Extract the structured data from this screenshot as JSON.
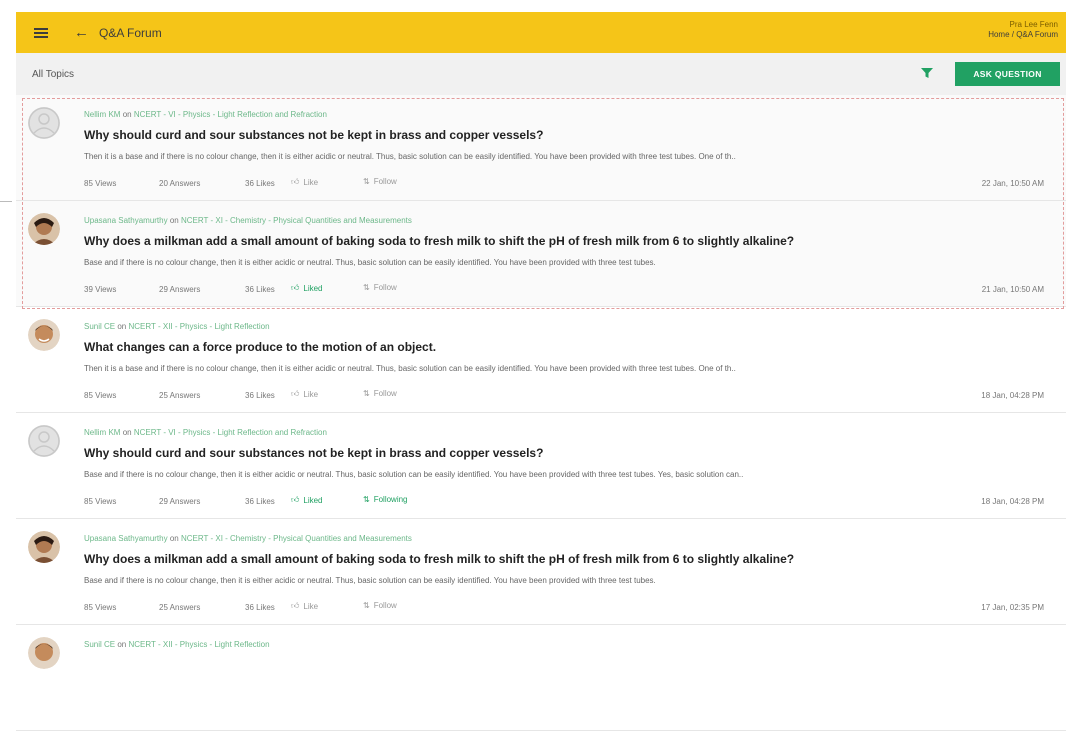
{
  "header": {
    "title": "Q&A Forum",
    "user_name": "Pra Lee Fenn",
    "breadcrumb": "Home / Q&A Forum"
  },
  "subheader": {
    "title": "All Topics",
    "ask_button": "ASK QUESTION"
  },
  "colors": {
    "brand": "#f5c518",
    "accent": "#21a163"
  },
  "icons": {
    "menu": "hamburger-icon",
    "back": "arrow-left-icon",
    "filter": "funnel-icon",
    "like": "thumbs-up-icon",
    "follow": "follow-icon"
  },
  "questions": [
    {
      "author": "Nellim KM",
      "on": "on",
      "topic": "NCERT - VI - Physics - Light Reflection and Refraction",
      "title": "Why should curd and sour substances not be kept in brass and copper vessels?",
      "snippet": "Then it is a base and if there is no colour change, then it is either acidic or neutral. Thus, basic solution can be easily identified. You have been provided with three test tubes. One of th..",
      "views": "85 Views",
      "answers": "20 Answers",
      "likes": "36 Likes",
      "like_label": "Like",
      "follow_label": "Follow",
      "date": "22 Jan, 10:50 AM"
    },
    {
      "author": "Upasana Sathyamurthy",
      "on": "on",
      "topic": "NCERT - XI - Chemistry - Physical Quantities and Measurements",
      "title": "Why does a milkman add a small amount of baking soda to fresh milk to shift the pH of fresh milk from 6 to slightly alkaline?",
      "snippet": "Base and if there is no colour change, then it is either acidic or neutral. Thus, basic solution can be easily identified. You have been provided with three test tubes.",
      "views": "39 Views",
      "answers": "29 Answers",
      "likes": "36 Likes",
      "like_label": "Liked",
      "follow_label": "Follow",
      "date": "21 Jan, 10:50 AM"
    },
    {
      "author": "Sunil CE",
      "on": "on",
      "topic": "NCERT - XII - Physics - Light Reflection",
      "title": "What changes can a force produce to the motion of an object.",
      "snippet": "Then it is a base and if there is no colour change, then it is either acidic or neutral. Thus, basic solution can be easily identified. You have been provided with three test tubes. One of th..",
      "views": "85 Views",
      "answers": "25 Answers",
      "likes": "36 Likes",
      "like_label": "Like",
      "follow_label": "Follow",
      "date": "18 Jan, 04:28 PM"
    },
    {
      "author": "Nellim KM",
      "on": "on",
      "topic": "NCERT - VI - Physics - Light Reflection and Refraction",
      "title": "Why should curd and sour substances not be kept in brass and copper vessels?",
      "snippet": "Base and if there is no colour change, then it is either acidic or neutral. Thus, basic solution can be easily identified. You have been provided with three test tubes. Yes, basic solution can..",
      "views": "85 Views",
      "answers": "29 Answers",
      "likes": "36 Likes",
      "like_label": "Liked",
      "follow_label": "Following",
      "date": "18 Jan, 04:28 PM"
    },
    {
      "author": "Upasana Sathyamurthy",
      "on": "on",
      "topic": "NCERT - XI - Chemistry - Physical Quantities and Measurements",
      "title": "Why does a milkman add a small amount of baking soda to fresh milk to shift the pH of fresh milk from 6 to slightly alkaline?",
      "snippet": "Base and if there is no colour change, then it is either acidic or neutral. Thus, basic solution can be easily identified. You have been provided with three test tubes.",
      "views": "85 Views",
      "answers": "25 Answers",
      "likes": "36 Likes",
      "like_label": "Like",
      "follow_label": "Follow",
      "date": "17 Jan, 02:35 PM"
    },
    {
      "author": "Sunil CE",
      "on": "on",
      "topic": "NCERT - XII - Physics - Light Reflection",
      "title": "",
      "snippet": "",
      "views": "",
      "answers": "",
      "likes": "",
      "like_label": "",
      "follow_label": "",
      "date": ""
    }
  ]
}
